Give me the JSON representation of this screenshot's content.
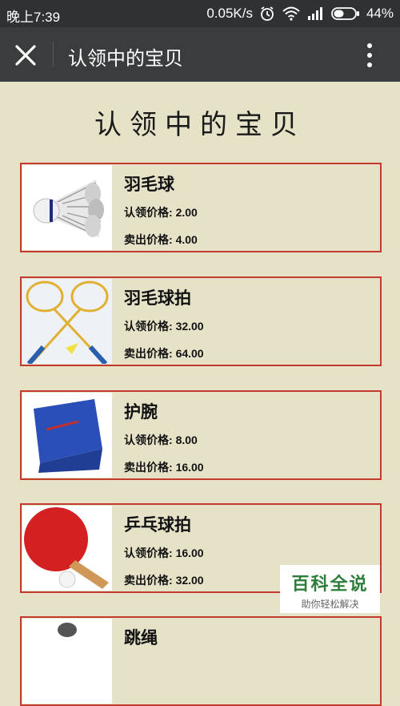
{
  "status_bar": {
    "time": "晚上7:39",
    "network_speed": "0.05K/s",
    "battery": "44%",
    "icons": [
      "alarm-icon",
      "wifi-icon",
      "signal-icon",
      "battery-icon"
    ]
  },
  "nav": {
    "title": "认领中的宝贝",
    "close_icon": "close-icon",
    "more_icon": "more-vertical-icon"
  },
  "page": {
    "title": "认领中的宝贝"
  },
  "items": [
    {
      "name": "羽毛球",
      "claim_label": "认领价格",
      "claim_price": "2.00",
      "sell_label": "卖出价格",
      "sell_price": "4.00",
      "thumb": "shuttlecock-image"
    },
    {
      "name": "羽毛球拍",
      "claim_label": "认领价格",
      "claim_price": "32.00",
      "sell_label": "卖出价格",
      "sell_price": "64.00",
      "thumb": "badminton-rackets-image"
    },
    {
      "name": "护腕",
      "claim_label": "认领价格",
      "claim_price": "8.00",
      "sell_label": "卖出价格",
      "sell_price": "16.00",
      "thumb": "wristband-image"
    },
    {
      "name": "乒乓球拍",
      "claim_label": "认领价格",
      "claim_price": "16.00",
      "sell_label": "卖出价格",
      "sell_price": "32.00",
      "thumb": "ping-pong-paddle-image"
    },
    {
      "name": "跳绳",
      "thumb": "jump-rope-image"
    }
  ],
  "watermark": {
    "main": "百科全说",
    "sub": "助你轻松解决"
  },
  "colors": {
    "background": "#e6e2c8",
    "card_border": "#c53a2e",
    "nav_bg": "#3a3c3e",
    "status_bg": "#2f3133"
  }
}
